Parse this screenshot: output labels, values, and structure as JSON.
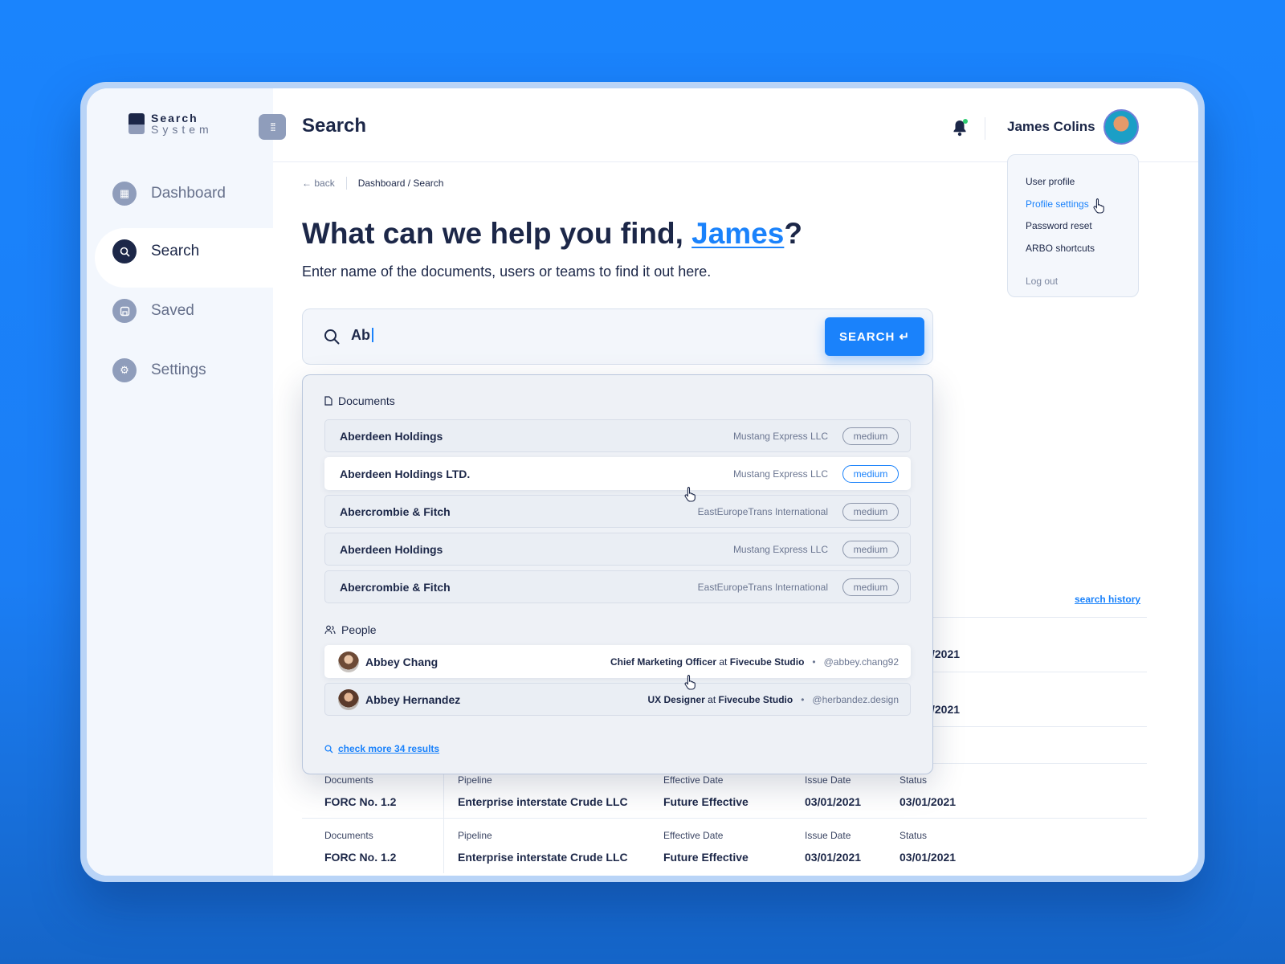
{
  "app": {
    "logo_line1": "Search",
    "logo_line2": "System"
  },
  "sidebar": {
    "items": [
      {
        "label": "Dashboard",
        "icon": "dashboard-icon"
      },
      {
        "label": "Search",
        "icon": "search-icon",
        "active": true
      },
      {
        "label": "Saved",
        "icon": "save-icon"
      },
      {
        "label": "Settings",
        "icon": "gear-icon"
      }
    ]
  },
  "header": {
    "title": "Search",
    "user_name": "James Colins"
  },
  "user_menu": {
    "items": [
      "User profile",
      "Profile settings",
      "Password reset",
      "ARBO shortcuts"
    ],
    "logout": "Log out",
    "highlighted": "Profile settings"
  },
  "breadcrumb": {
    "back": "back",
    "path": "Dashboard / Search"
  },
  "hero": {
    "headline_prefix": "What can we help you find, ",
    "headline_name": "James",
    "headline_suffix": "?",
    "subline": "Enter name of the documents, users or teams to find it out here."
  },
  "search": {
    "value": "Ab",
    "button_label": "SEARCH ↵"
  },
  "dropdown": {
    "documents_title": "Documents",
    "documents": [
      {
        "title": "Aberdeen Holdings",
        "company": "Mustang Express LLC",
        "tag": "medium"
      },
      {
        "title": "Aberdeen Holdings LTD.",
        "company": "Mustang Express LLC",
        "tag": "medium",
        "selected": true
      },
      {
        "title": "Abercrombie & Fitch",
        "company": "EastEuropeTrans International",
        "tag": "medium"
      },
      {
        "title": "Aberdeen Holdings",
        "company": "Mustang Express LLC",
        "tag": "medium"
      },
      {
        "title": "Abercrombie & Fitch",
        "company": "EastEuropeTrans International",
        "tag": "medium"
      }
    ],
    "people_title": "People",
    "people": [
      {
        "name": "Abbey Chang",
        "role": "Chief Marketing Officer",
        "at": "at",
        "company": "Fivecube Studio",
        "bullet": "•",
        "handle": "@abbey.chang92",
        "selected": true
      },
      {
        "name": "Abbey Hernandez",
        "role": "UX Designer",
        "at": "at",
        "company": "Fivecube Studio",
        "bullet": "•",
        "handle": "@herbandez.design"
      }
    ],
    "more_link": "check more 34 results"
  },
  "history_link": "search history",
  "peek": {
    "date1": "/2021",
    "date2": "/2021"
  },
  "table": {
    "headers": [
      "Documents",
      "Pipeline",
      "Effective Date",
      "Issue Date",
      "Status"
    ],
    "rows": [
      [
        "FORC No. 1.2",
        "Enterprise interstate Crude LLC",
        "Future Effective",
        "03/01/2021",
        "03/01/2021"
      ],
      [
        "FORC No. 1.2",
        "Enterprise interstate Crude LLC",
        "Future Effective",
        "03/01/2021",
        "03/01/2021"
      ]
    ]
  },
  "colors": {
    "accent": "#1a82fb",
    "navy": "#1c2748",
    "muted": "#6b7691",
    "background": "#1a84fd"
  }
}
